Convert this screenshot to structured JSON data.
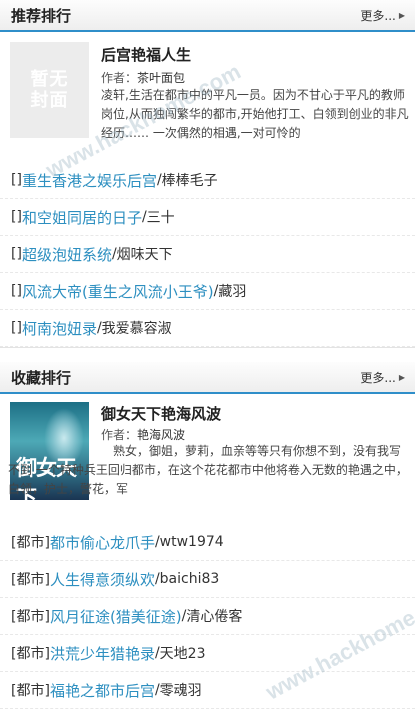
{
  "recommend": {
    "title": "推荐排行",
    "more": "更多...",
    "featured": {
      "cover_placeholder": "暂无封面",
      "title": "后宫艳福人生",
      "author_label": "作者：",
      "author": "茶叶面包",
      "description": "凌轩,生活在都市中的平凡一员。因为不甘心于平凡的教师岗位,从而独闯繁华的都市,开始他打工、白领到创业的非凡经历…… 一次偶然的相遇,一对可怜的"
    },
    "items": [
      {
        "category": "[]",
        "name": "重生香港之娱乐后宫",
        "sep": "/",
        "author": "棒棒毛子"
      },
      {
        "category": "[]",
        "name": "和空姐同居的日子",
        "sep": "/",
        "author": "三十"
      },
      {
        "category": "[]",
        "name": "超级泡妞系统",
        "sep": "/",
        "author": "烟味天下"
      },
      {
        "category": "[]",
        "name": "风流大帝(重生之风流小王爷)",
        "sep": "/",
        "author": "藏羽"
      },
      {
        "category": "[]",
        "name": "柯南泡妞录",
        "sep": "/",
        "author": "我爱慕容淑"
      }
    ]
  },
  "favorites": {
    "title": "收藏排行",
    "more": "更多...",
    "featured": {
      "cover_title": "御女天下",
      "title": "御女天下艳海风波",
      "author_label": "作者：",
      "author": "艳海风波",
      "description": "熟女，御姐，萝莉，血亲等等只有你想不到，没有我写不到 一个特种兵王回归都市，在这个花花都市中他将卷入无数的艳遇之中，白领，护士，警花，军"
    },
    "items": [
      {
        "category": "[都市]",
        "name": "都市偷心龙爪手",
        "sep": "/",
        "author": "wtw1974"
      },
      {
        "category": "[都市]",
        "name": "人生得意须纵欢",
        "sep": "/",
        "author": "baichi83"
      },
      {
        "category": "[都市]",
        "name": "风月征途(猎美征途)",
        "sep": "/",
        "author": "清心倦客"
      },
      {
        "category": "[都市]",
        "name": "洪荒少年猎艳录",
        "sep": "/",
        "author": "天地23"
      },
      {
        "category": "[都市]",
        "name": "福艳之都市后宫",
        "sep": "/",
        "author": "零魂羽"
      }
    ]
  },
  "watermarks": [
    "www.hackhome.com",
    "www.hackhome.com"
  ]
}
